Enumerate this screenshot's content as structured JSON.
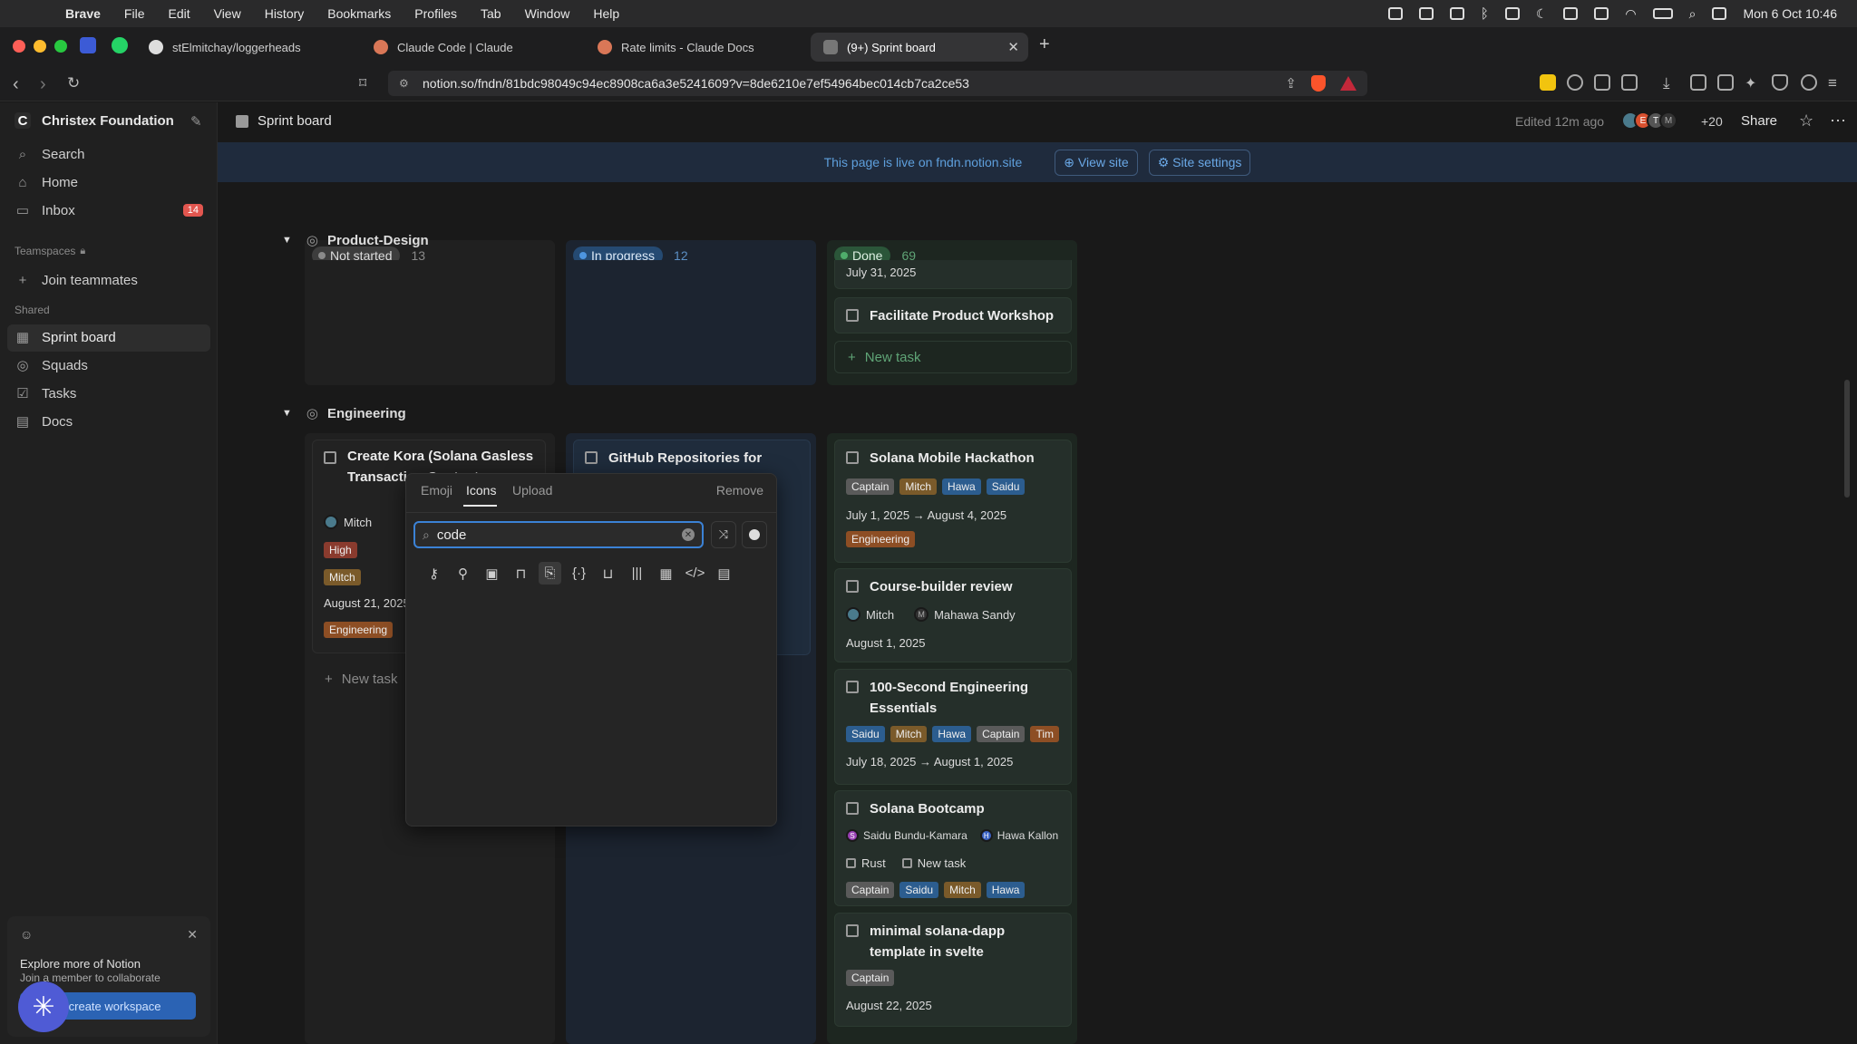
{
  "menubar": {
    "app": "Brave",
    "items": [
      "File",
      "Edit",
      "View",
      "History",
      "Bookmarks",
      "Profiles",
      "Tab",
      "Window",
      "Help"
    ],
    "clock": "Mon 6 Oct  10:46"
  },
  "tabs": [
    {
      "label": "stElmitchay/loggerheads"
    },
    {
      "label": "Claude Code | Claude"
    },
    {
      "label": "Rate limits - Claude Docs"
    },
    {
      "label": "(9+) Sprint board"
    }
  ],
  "url": "notion.so/fndn/81bdc98049c94ec8908ca6a3e5241609?v=8de6210e7ef54964bec014cb7ca2ce53",
  "sidebar": {
    "workspace": "Christex Foundation",
    "search": "Search",
    "home": "Home",
    "inbox": "Inbox",
    "inbox_count": "14",
    "teamspaces": "Teamspaces",
    "join": "Join teammates",
    "shared": "Shared",
    "items": [
      "Sprint board",
      "Squads",
      "Tasks",
      "Docs"
    ],
    "promo_title": "Explore more of Notion",
    "promo_sub": "Join a member to collaborate",
    "promo_btn": "or create workspace"
  },
  "topbar": {
    "page": "Sprint board",
    "edited": "Edited 12m ago",
    "more_count": "+20",
    "share": "Share",
    "avatars": [
      "E",
      "T",
      "M"
    ]
  },
  "banner": {
    "text": "This page is live on fndn.notion.site",
    "view": "View site",
    "settings": "Site settings"
  },
  "board": {
    "columns": [
      {
        "label": "Not started",
        "count": "13"
      },
      {
        "label": "In progress",
        "count": "12"
      },
      {
        "label": "Done",
        "count": "69"
      }
    ],
    "groups": [
      "Product-Design",
      "Engineering"
    ],
    "pd_done": {
      "date": "July 31, 2025",
      "card": "Facilitate Product Workshop",
      "new": "New task"
    },
    "eng_ns": {
      "title": "Create Kora (Solana Gasless Transaction Content",
      "person": "Mitch",
      "priority": "High",
      "owner": "Mitch",
      "date": "August 21, 2025",
      "tag": "Engineering",
      "new": "New task"
    },
    "eng_ip": {
      "title": "GitHub Repositories for"
    },
    "eng_done": [
      {
        "title": "Solana Mobile Hackathon",
        "tags": [
          "Captain",
          "Mitch",
          "Hawa",
          "Saidu"
        ],
        "date": "July 1, 2025 → August 4, 2025",
        "tag2": "Engineering"
      },
      {
        "title": "Course-builder review",
        "p1": "Mitch",
        "p2": "Mahawa Sandy",
        "date": "August 1, 2025"
      },
      {
        "title": "100-Second Engineering Essentials",
        "tags": [
          "Saidu",
          "Mitch",
          "Hawa",
          "Captain",
          "Tim"
        ],
        "date": "July 18, 2025 → August 1, 2025"
      },
      {
        "title": "Solana Bootcamp",
        "p1": "Saidu Bundu-Kamara",
        "p2": "Hawa Kallon",
        "sub1": "Rust",
        "sub2": "New task",
        "tags": [
          "Captain",
          "Saidu",
          "Mitch",
          "Hawa"
        ]
      },
      {
        "title": "minimal solana-dapp template in svelte",
        "tags": [
          "Captain"
        ],
        "date": "August 22, 2025"
      }
    ]
  },
  "picker": {
    "tabs": [
      "Emoji",
      "Icons",
      "Upload"
    ],
    "remove": "Remove",
    "query": "code"
  }
}
